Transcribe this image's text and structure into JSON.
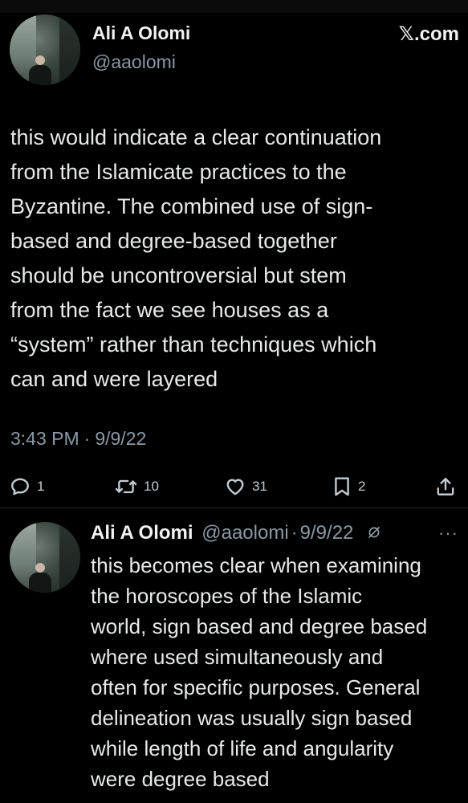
{
  "main_tweet": {
    "author": {
      "display_name": "Ali A Olomi",
      "handle": "@aaolomi"
    },
    "brand": "𝕏.com",
    "text_lines": [
      "this would indicate a clear continuation",
      "from the Islamicate practices to the",
      "Byzantine. The combined use of sign-",
      "based and degree-based together",
      "should be uncontroversial but stem",
      "from the fact we see houses as a",
      "“system” rather than techniques which",
      "can and were layered"
    ],
    "time": "3:43 PM",
    "separator": "·",
    "date": "9/9/22",
    "actions": {
      "replies": "1",
      "retweets": "10",
      "likes": "31",
      "bookmarks": "2"
    }
  },
  "reply_tweet": {
    "author": {
      "display_name": "Ali A Olomi",
      "handle": "@aaolomi"
    },
    "separator": "·",
    "date": "9/9/22",
    "more": "···",
    "text_lines": [
      "this becomes clear when examining",
      "the horoscopes of the Islamic",
      "world, sign based and degree based",
      "where used simultaneously and",
      "often for specific purposes. General",
      "delineation was usually sign based",
      "while length of life and angularity",
      "were degree based"
    ]
  },
  "icons": {
    "reply": "reply-icon",
    "retweet": "retweet-icon",
    "like": "heart-icon",
    "bookmark": "bookmark-icon",
    "share": "share-icon",
    "grok": "grok-icon",
    "more": "more-icon"
  },
  "colors": {
    "background": "#000000",
    "text": "#e7e9ea",
    "muted": "#8b98a5"
  }
}
